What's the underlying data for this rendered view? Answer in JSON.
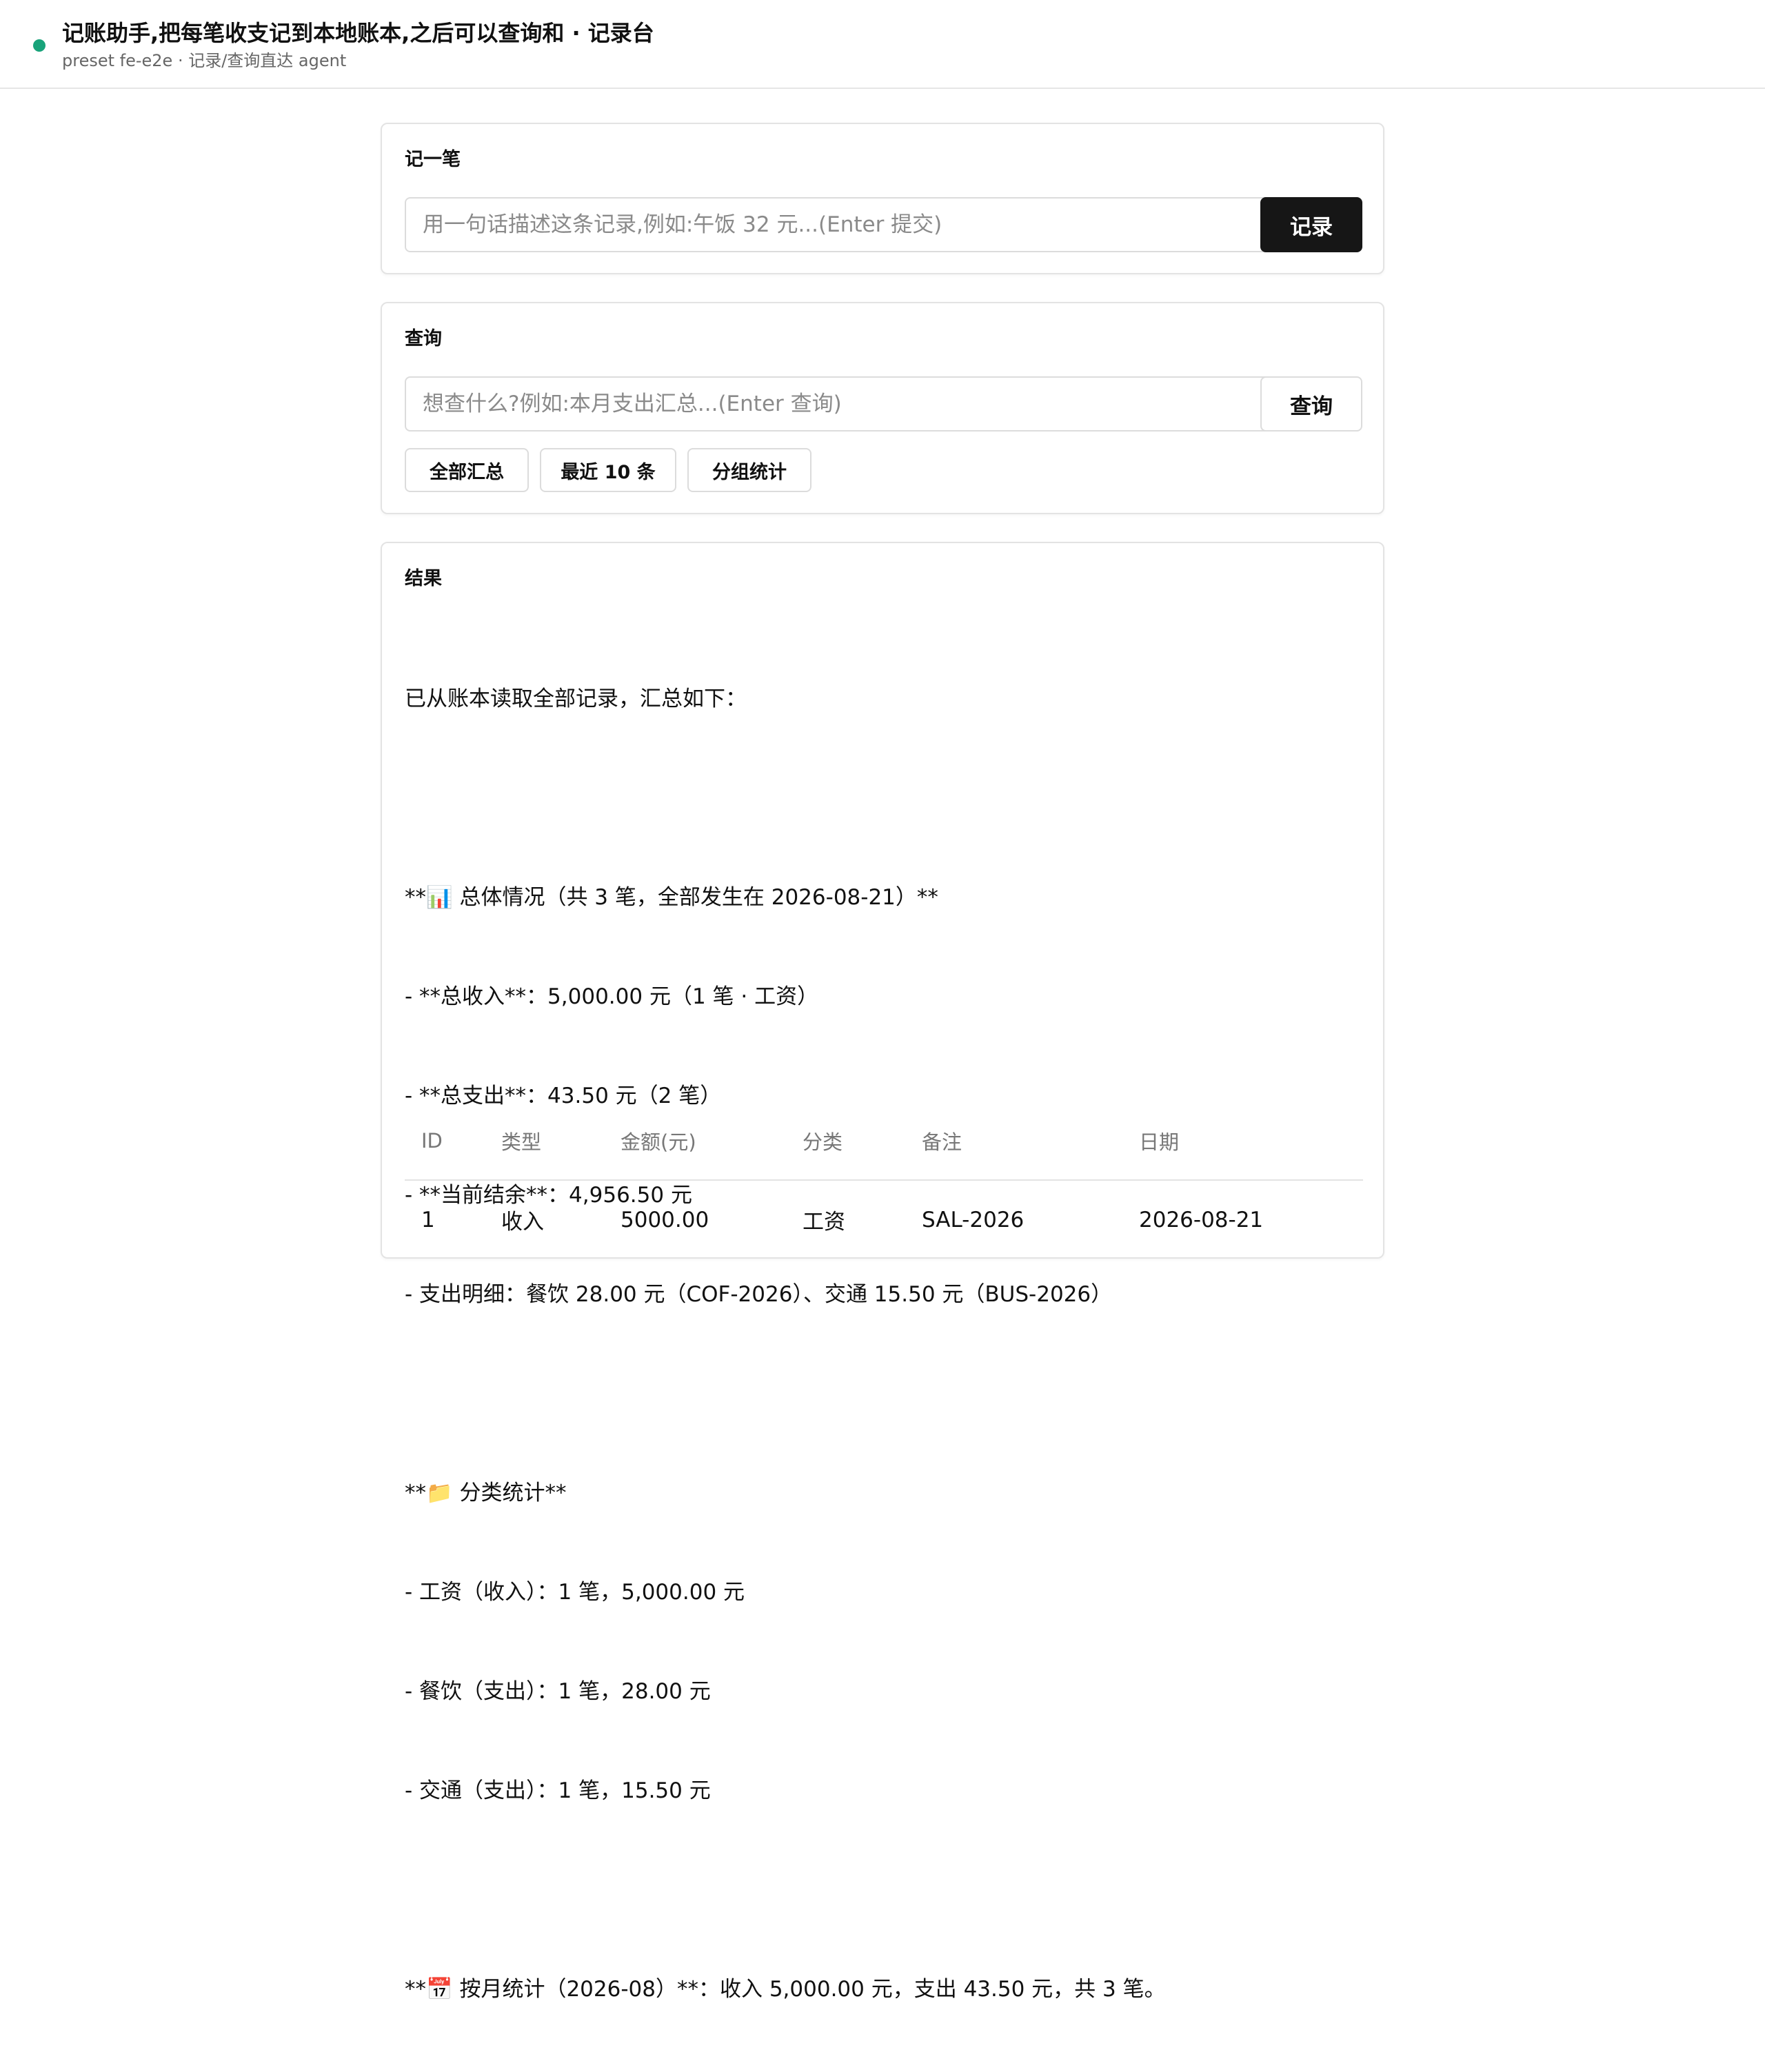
{
  "header": {
    "title": "记账助手,把每笔收支记到本地账本,之后可以查询和 · 记录台",
    "subtitle": "preset fe-e2e · 记录/查询直达 agent",
    "status_color": "#18a37a"
  },
  "record": {
    "title": "记一笔",
    "placeholder": "用一句话描述这条记录,例如:午饭 32 元...(Enter 提交)",
    "button": "记录"
  },
  "query": {
    "title": "查询",
    "placeholder": "想查什么?例如:本月支出汇总...(Enter 查询)",
    "button": "查询",
    "quick": [
      "全部汇总",
      "最近 10 条",
      "分组统计"
    ]
  },
  "result": {
    "title": "结果",
    "lines": [
      "已从账本读取全部记录，汇总如下：",
      "",
      "**📊 总体情况（共 3 笔，全部发生在 2026-08-21）**",
      "- **总收入**：5,000.00 元（1 笔 · 工资）",
      "- **总支出**：43.50 元（2 笔）",
      "- **当前结余**：4,956.50 元",
      "- 支出明细：餐饮 28.00 元（COF-2026）、交通 15.50 元（BUS-2026）",
      "",
      "**📁 分类统计**",
      "- 工资（收入）：1 笔，5,000.00 元",
      "- 餐饮（支出）：1 笔，28.00 元",
      "- 交通（支出）：1 笔，15.50 元",
      "",
      "**📅 按月统计（2026-08）**：收入 5,000.00 元，支出 43.50 元，共 3 笔。"
    ],
    "table": {
      "headers": [
        "ID",
        "类型",
        "金额(元)",
        "分类",
        "备注",
        "日期"
      ],
      "rows": [
        [
          "1",
          "收入",
          "5000.00",
          "工资",
          "SAL-2026",
          "2026-08-21"
        ]
      ]
    }
  }
}
